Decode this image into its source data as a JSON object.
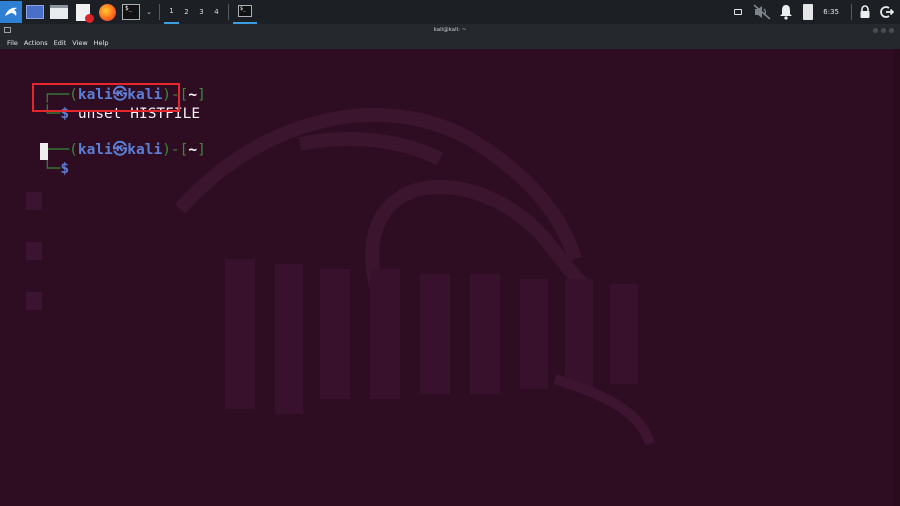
{
  "taskbar": {
    "workspaces": [
      "1",
      "2",
      "3",
      "4"
    ],
    "clock": "6:35"
  },
  "window": {
    "title": "kali@kali: ~",
    "menu": [
      "File",
      "Actions",
      "Edit",
      "View",
      "Help"
    ]
  },
  "terminal": {
    "prompt_user": "kali",
    "prompt_host": "kali",
    "prompt_dir": "~",
    "prompt_symbol": "$",
    "command": "unset HISTFILE"
  },
  "colors": {
    "background": "#2e0c22",
    "prompt_frame": "#3a8a3a",
    "prompt_user": "#5c7fd6",
    "highlight_box": "#e5262a",
    "panel_accent": "#3d9de3"
  }
}
